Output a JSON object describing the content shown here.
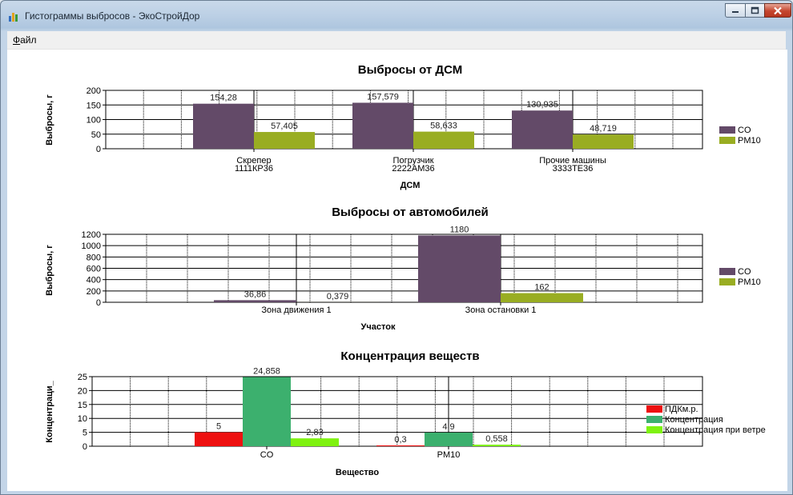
{
  "window": {
    "title": "Гистограммы выбросов - ЭкоСтройДор",
    "controls": {
      "minimize": "minimize-icon",
      "maximize": "maximize-icon",
      "close": "close-icon"
    }
  },
  "menu": {
    "file_accel": "Ф",
    "file_rest": "айл"
  },
  "colors": {
    "CO": "#634a68",
    "PM10": "#99ad22",
    "PDK": "#ee1111",
    "Conc": "#3cb06e",
    "ConcWind": "#7ff210"
  },
  "chart_data": [
    {
      "type": "bar",
      "title": "Выбросы от ДСМ",
      "xlabel": "ДСМ",
      "ylabel": "Выбросы, г",
      "ylim": [
        0,
        200
      ],
      "yticks": [
        0,
        50,
        100,
        150,
        200
      ],
      "categories": [
        [
          "Скрепер",
          "1111КР36"
        ],
        [
          "Погрузчик",
          "2222АМ36"
        ],
        [
          "Прочие машины",
          "3333ТЕ36"
        ]
      ],
      "series": [
        {
          "name": "CO",
          "values": [
            154.28,
            157.579,
            130.935
          ],
          "labels": [
            "154,28",
            "157,579",
            "130,935"
          ]
        },
        {
          "name": "PM10",
          "values": [
            57.405,
            58.633,
            48.719
          ],
          "labels": [
            "57,405",
            "58,633",
            "48,719"
          ]
        }
      ],
      "legend": "right"
    },
    {
      "type": "bar",
      "title": "Выбросы от автомобилей",
      "xlabel": "Участок",
      "ylabel": "Выбросы, г",
      "ylim": [
        0,
        1200
      ],
      "yticks": [
        0,
        200,
        400,
        600,
        800,
        1000,
        1200
      ],
      "categories": [
        [
          "Зона движения 1"
        ],
        [
          "Зона остановки 1"
        ]
      ],
      "series": [
        {
          "name": "CO",
          "values": [
            36.86,
            1180
          ],
          "labels": [
            "36,86",
            "1180"
          ]
        },
        {
          "name": "PM10",
          "values": [
            0.379,
            162
          ],
          "labels": [
            "0,379",
            "162"
          ]
        }
      ],
      "legend": "right"
    },
    {
      "type": "bar",
      "title": "Концентрация веществ",
      "xlabel": "Вещество",
      "ylabel": "Концентраци_",
      "ylim": [
        0,
        25
      ],
      "yticks": [
        0,
        5,
        10,
        15,
        20,
        25
      ],
      "categories": [
        [
          "CO"
        ],
        [
          "PM10"
        ]
      ],
      "series": [
        {
          "name": "ПДКм.р.",
          "values": [
            5,
            0.3
          ],
          "labels": [
            "5",
            "0,3"
          ]
        },
        {
          "name": "Концентрация",
          "values": [
            24.858,
            4.9
          ],
          "labels": [
            "24,858",
            "4,9"
          ]
        },
        {
          "name": "Концентрация при ветре",
          "values": [
            2.83,
            0.558
          ],
          "labels": [
            "2,83",
            "0,558"
          ]
        }
      ],
      "legend": "right"
    }
  ]
}
